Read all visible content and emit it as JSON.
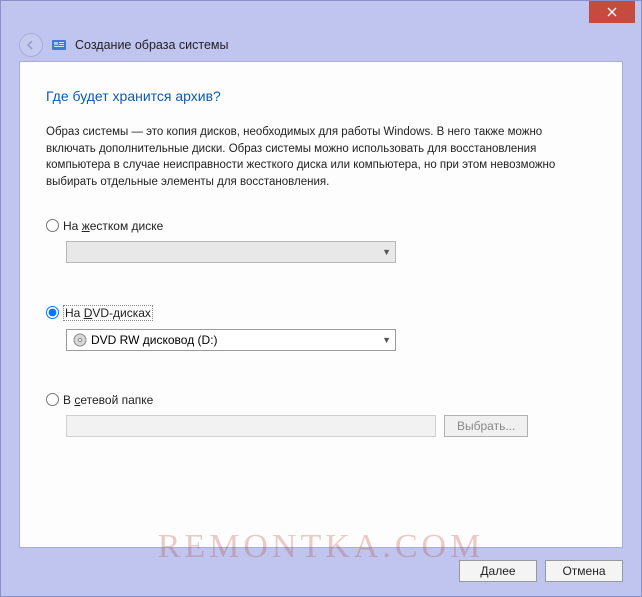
{
  "window": {
    "title": "Создание образа системы"
  },
  "page": {
    "heading": "Где будет хранится архив?",
    "description": "Образ системы — это копия дисков, необходимых для работы Windows. В него также можно включать дополнительные диски. Образ системы можно использовать для восстановления компьютера в случае неисправности жесткого диска или компьютера, но при этом невозможно выбирать отдельные элементы для восстановления."
  },
  "options": {
    "hdd": {
      "prefix": "На ",
      "key": "ж",
      "suffix": "естком диске",
      "selected": false,
      "combo_value": ""
    },
    "dvd": {
      "prefix": "На ",
      "key": "D",
      "suffix": "VD-дисках",
      "selected": true,
      "combo_value": "DVD RW дисковод (D:)"
    },
    "network": {
      "prefix": "В ",
      "key": "с",
      "suffix": "етевой папке",
      "selected": false,
      "input_value": "",
      "browse_label": "Выбрать..."
    }
  },
  "footer": {
    "next": "Далее",
    "cancel": "Отмена"
  },
  "watermark": "REMONTKA.COM"
}
